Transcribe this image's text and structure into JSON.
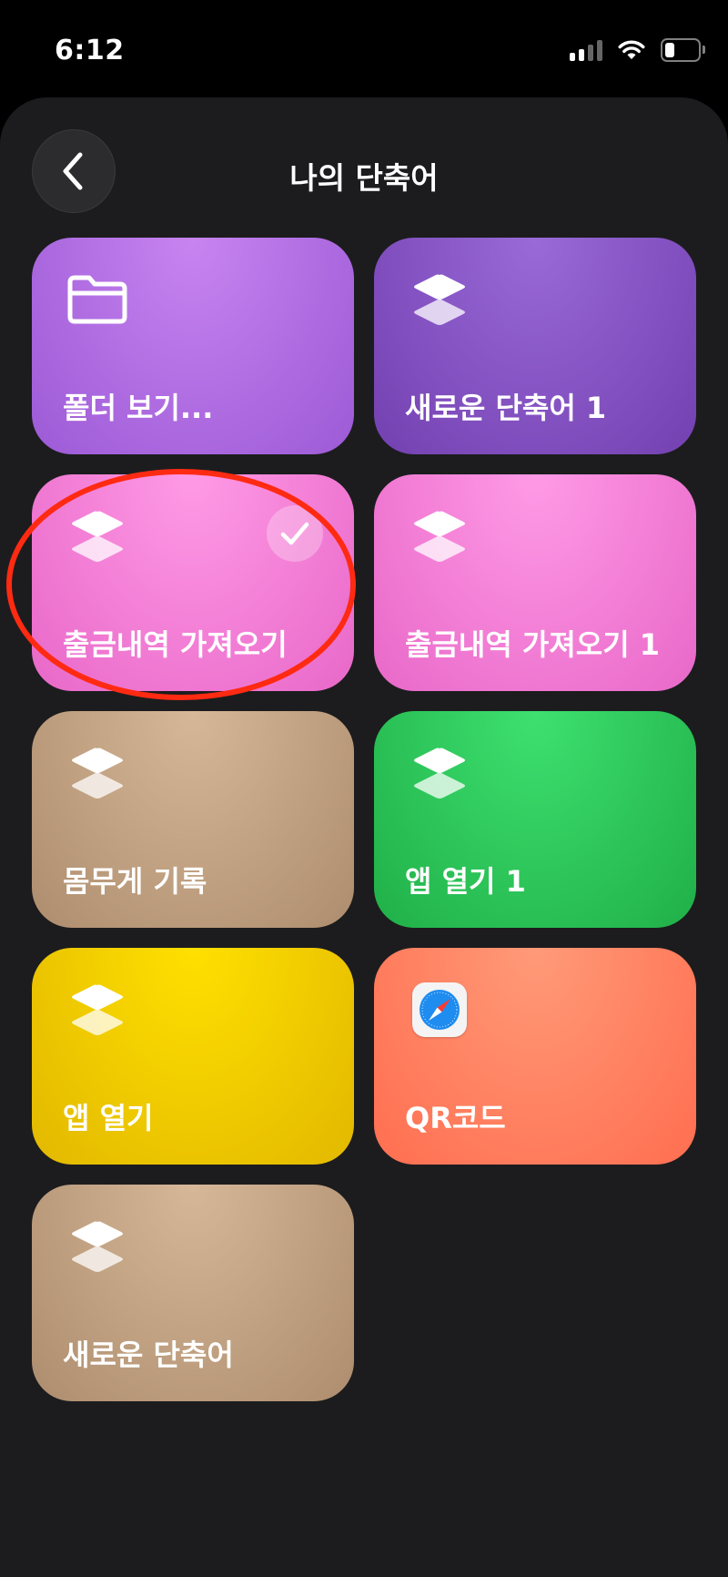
{
  "status_bar": {
    "time": "6:12",
    "battery_level": 0.3
  },
  "header": {
    "title": "나의 단축어",
    "back_icon": "chevron-left-icon"
  },
  "tiles": [
    {
      "label": "폴더 보기...",
      "icon": "folder-icon",
      "color_start": "#c884f0",
      "color_end": "#9c5ad6",
      "selected": false
    },
    {
      "label": "새로운 단축어 1",
      "icon": "stack-icon",
      "color_start": "#9a6ad8",
      "color_end": "#7340b0",
      "selected": false
    },
    {
      "label": "출금내역 가져오기",
      "icon": "stack-icon",
      "color_start": "#ff9ae6",
      "color_end": "#e868c8",
      "selected": true
    },
    {
      "label": "출금내역 가져오기 1",
      "icon": "stack-icon",
      "color_start": "#ff9ae6",
      "color_end": "#e868c8",
      "selected": false
    },
    {
      "label": "몸무게 기록",
      "icon": "stack-icon",
      "color_start": "#d6b898",
      "color_end": "#ad8d6e",
      "selected": false
    },
    {
      "label": "앱 열기 1",
      "icon": "stack-icon",
      "color_start": "#3ee070",
      "color_end": "#20b048",
      "selected": false
    },
    {
      "label": "앱 열기",
      "icon": "stack-icon",
      "color_start": "#ffe000",
      "color_end": "#e2b800",
      "selected": false
    },
    {
      "label": "QR코드",
      "icon": "safari-icon",
      "color_start": "#ff9a78",
      "color_end": "#ff6e50",
      "selected": false
    },
    {
      "label": "새로운 단축어",
      "icon": "stack-icon",
      "color_start": "#d6b898",
      "color_end": "#ad8d6e",
      "selected": false
    }
  ],
  "annotation_color": "#ff2a12"
}
